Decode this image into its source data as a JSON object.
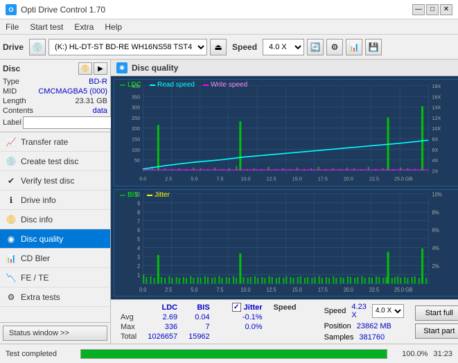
{
  "app": {
    "title": "Opti Drive Control 1.70",
    "icon": "O"
  },
  "titlebar": {
    "minimize": "—",
    "maximize": "□",
    "close": "✕"
  },
  "menubar": {
    "items": [
      "File",
      "Start test",
      "Extra",
      "Help"
    ]
  },
  "toolbar": {
    "drive_label": "Drive",
    "drive_value": "(K:) HL-DT-ST BD-RE  WH16NS58 TST4",
    "speed_label": "Speed",
    "speed_value": "4.0 X"
  },
  "disc": {
    "title": "Disc",
    "type_label": "Type",
    "type_value": "BD-R",
    "mid_label": "MID",
    "mid_value": "CMCMAGBA5 (000)",
    "length_label": "Length",
    "length_value": "23.31 GB",
    "contents_label": "Contents",
    "contents_value": "data",
    "label_label": "Label",
    "label_value": ""
  },
  "nav": {
    "items": [
      {
        "id": "transfer-rate",
        "label": "Transfer rate",
        "icon": "📈"
      },
      {
        "id": "create-test-disc",
        "label": "Create test disc",
        "icon": "💿"
      },
      {
        "id": "verify-test-disc",
        "label": "Verify test disc",
        "icon": "✔"
      },
      {
        "id": "drive-info",
        "label": "Drive info",
        "icon": "ℹ"
      },
      {
        "id": "disc-info",
        "label": "Disc info",
        "icon": "📀"
      },
      {
        "id": "disc-quality",
        "label": "Disc quality",
        "icon": "◉",
        "active": true
      },
      {
        "id": "cd-bler",
        "label": "CD Bler",
        "icon": "📊"
      },
      {
        "id": "fe-te",
        "label": "FE / TE",
        "icon": "📉"
      },
      {
        "id": "extra-tests",
        "label": "Extra tests",
        "icon": "⚙"
      }
    ]
  },
  "disc_quality": {
    "title": "Disc quality",
    "legend": {
      "ldc": "LDC",
      "read_speed": "Read speed",
      "write_speed": "Write speed"
    },
    "legend2": {
      "bis": "BIS",
      "jitter": "Jitter"
    },
    "chart1": {
      "y_max": 400,
      "y_labels_left": [
        400,
        350,
        300,
        250,
        200,
        150,
        100,
        50
      ],
      "y_labels_right": [
        "18X",
        "16X",
        "14X",
        "12X",
        "10X",
        "8X",
        "6X",
        "4X",
        "2X"
      ],
      "x_labels": [
        "0.0",
        "2.5",
        "5.0",
        "7.5",
        "10.0",
        "12.5",
        "15.0",
        "17.5",
        "20.0",
        "22.5",
        "25.0 GB"
      ]
    },
    "chart2": {
      "y_max": 10,
      "y_labels_left": [
        10,
        9,
        8,
        7,
        6,
        5,
        4,
        3,
        2,
        1
      ],
      "y_labels_right": [
        "10%",
        "8%",
        "6%",
        "4%",
        "2%"
      ],
      "x_labels": [
        "0.0",
        "2.5",
        "5.0",
        "7.5",
        "10.0",
        "12.5",
        "15.0",
        "17.5",
        "20.0",
        "22.5",
        "25.0 GB"
      ]
    }
  },
  "stats": {
    "headers": [
      "",
      "LDC",
      "BIS",
      "",
      "Jitter",
      "Speed",
      "",
      ""
    ],
    "avg": {
      "label": "Avg",
      "ldc": "2.69",
      "bis": "0.04",
      "jitter": "-0.1%"
    },
    "max": {
      "label": "Max",
      "ldc": "336",
      "bis": "7",
      "jitter": "0.0%"
    },
    "total": {
      "label": "Total",
      "ldc": "1026657",
      "bis": "15962"
    },
    "speed_val": "4.23 X",
    "speed_select": "4.0 X",
    "position_label": "Position",
    "position_val": "23862 MB",
    "samples_label": "Samples",
    "samples_val": "381760",
    "jitter_checked": "✓",
    "start_full": "Start full",
    "start_part": "Start part"
  },
  "statusbar": {
    "status_text": "Test completed",
    "progress_pct": "100.0%",
    "time": "31:23"
  },
  "status_window": {
    "label": "Status window >>"
  },
  "colors": {
    "ldc_green": "#00ff00",
    "read_speed_cyan": "#00ffff",
    "bis_green": "#00cc00",
    "jitter_yellow": "#ffff00",
    "chart_bg": "#1e4a7a",
    "chart_grid": "#2a6aaa",
    "accent_blue": "#0078d7"
  }
}
